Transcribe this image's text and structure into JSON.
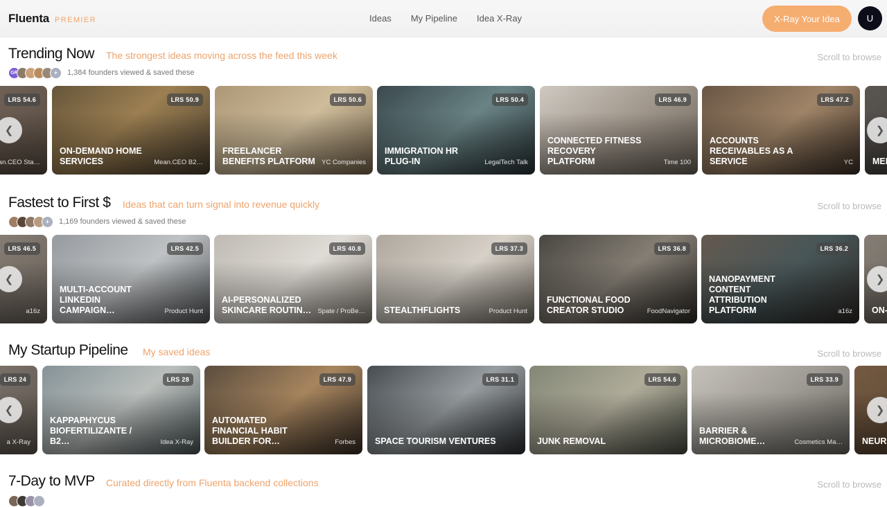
{
  "header": {
    "brand_name": "Fluenta",
    "brand_tier": "PREMIER",
    "nav": [
      "Ideas",
      "My Pipeline",
      "Idea X-Ray"
    ],
    "cta_label": "X-Ray Your Idea",
    "avatar_initial": "U"
  },
  "colors": {
    "accent": "#f6ad70",
    "subtitle": "#eea36b",
    "score_badge": "#464646"
  },
  "icons": {
    "left_arrow": "chevron-left-icon",
    "right_arrow": "chevron-right-icon"
  },
  "sections": [
    {
      "title": "Trending Now",
      "subtitle": "The strongest ideas moving across the feed this week",
      "scroll_hint": "Scroll to browse",
      "social_badge": "GR",
      "social_text": "1,384 founders viewed & saved these",
      "cards": [
        {
          "title": "",
          "score": "LRS 54.6",
          "source": "Mean.CEO Sta…"
        },
        {
          "title": "On-Demand Home Services",
          "score": "LRS 50.9",
          "source": "Mean.CEO B2…"
        },
        {
          "title": "Freelancer Benefits Platform",
          "score": "LRS 50.6",
          "source": "YC Companies"
        },
        {
          "title": "Immigration HR Plug-In",
          "score": "LRS 50.4",
          "source": "LegalTech Talk"
        },
        {
          "title": "Connected Fitness Recovery Platform",
          "score": "LRS 46.9",
          "source": "Time 100"
        },
        {
          "title": "Accounts Receivables as a Service",
          "score": "LRS 47.2",
          "source": "YC"
        },
        {
          "title": "Men Med",
          "score": "",
          "source": ""
        }
      ]
    },
    {
      "title": "Fastest to First $",
      "subtitle": "Ideas that can turn signal into revenue quickly",
      "scroll_hint": "Scroll to browse",
      "social_badge": "",
      "social_text": "1,169 founders viewed & saved these",
      "cards": [
        {
          "title": "",
          "score": "LRS 46.5",
          "source": "a16z"
        },
        {
          "title": "Multi-Account LinkedIn Campaign…",
          "score": "LRS 42.5",
          "source": "Product Hunt"
        },
        {
          "title": "AI-Personalized Skincare Routin…",
          "score": "LRS 40.8",
          "source": "Spate / ProBe…"
        },
        {
          "title": "StealthFlights",
          "score": "LRS 37.3",
          "source": "Product Hunt"
        },
        {
          "title": "Functional Food Creator Studio",
          "score": "LRS 36.8",
          "source": "FoodNavigator"
        },
        {
          "title": "Nanopayment Content Attribution Platform",
          "score": "LRS 36.2",
          "source": "a16z"
        },
        {
          "title": "On- Ent",
          "score": "",
          "source": ""
        }
      ]
    },
    {
      "title": "My Startup Pipeline",
      "subtitle": "My saved ideas",
      "scroll_hint": "Scroll to browse",
      "social_badge": "",
      "social_text": "",
      "cards": [
        {
          "title": "",
          "score": "LRS 24",
          "source": "a X-Ray"
        },
        {
          "title": "Kappaphycus Biofertilizante / B2…",
          "score": "LRS 28",
          "source": "Idea X-Ray"
        },
        {
          "title": "Automated Financial Habit Builder For…",
          "score": "LRS 47.9",
          "source": "Forbes"
        },
        {
          "title": "Space Tourism Ventures",
          "score": "LRS 31.1",
          "source": ""
        },
        {
          "title": "Junk Removal",
          "score": "LRS 54.6",
          "source": ""
        },
        {
          "title": "Barrier & Microbiome…",
          "score": "LRS 33.9",
          "source": "Cosmetics Ma…"
        },
        {
          "title": "Neur & Moc",
          "score": "",
          "source": ""
        }
      ]
    },
    {
      "title": "7-Day to MVP",
      "subtitle": "Curated directly from Fluenta backend collections",
      "scroll_hint": "Scroll to browse",
      "social_badge": "",
      "social_text": "",
      "cards": []
    }
  ]
}
